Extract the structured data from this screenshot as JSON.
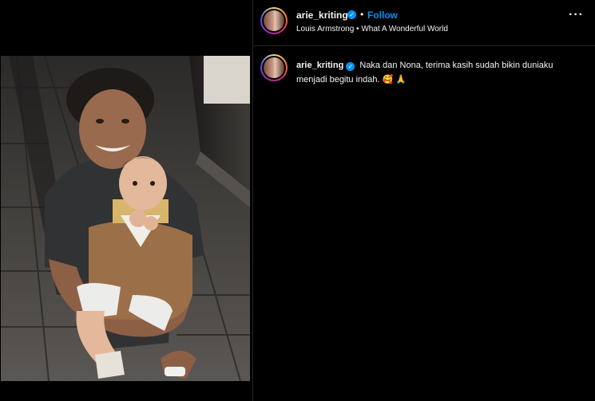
{
  "post": {
    "username": "arie_kriting",
    "verified_glyph": "✓",
    "separator": "•",
    "follow_label": "Follow",
    "audio": "Louis Armstrong • What A Wonderful World",
    "more_label": "···",
    "verified_color": "#0095f6",
    "follow_color": "#0095f6",
    "background": "#000000"
  },
  "caption": {
    "username": "arie_kriting",
    "verified_glyph": "✓",
    "text": "Naka dan Nona, terima kasih sudah bikin duniaku menjadi begitu indah. 🥰 🙏"
  },
  "media": {
    "icons": [
      "verified-badge-icon",
      "more-options-icon"
    ]
  }
}
